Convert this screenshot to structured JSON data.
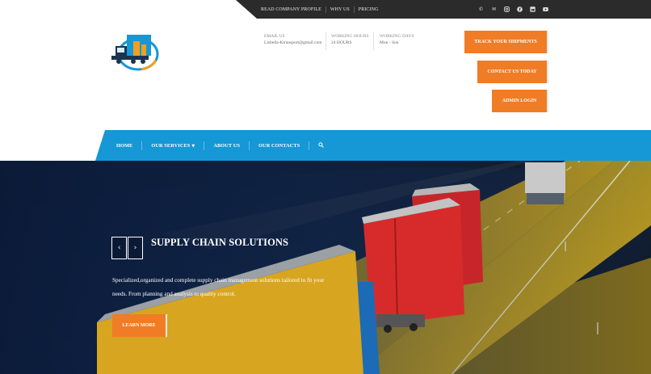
{
  "topnav": {
    "items": [
      "READ COMPANY PROFILE",
      "WHY US",
      "PRICING"
    ]
  },
  "social_icons": [
    "phone-icon",
    "mail-icon",
    "instagram-icon",
    "facebook-icon",
    "linkedin-icon",
    "youtube-icon"
  ],
  "header": {
    "email_label": "EMAIL US",
    "email_value": "Lisbella-Ktransport@gmail.com",
    "hours_label": "WORKING HOURS",
    "hours_value": "24 HOURS",
    "days_label": "WORKING DAYS",
    "days_value": "Mon - Sun"
  },
  "buttons": {
    "track": "TRACK YOUR SHIPMENTS",
    "contact": "CONTACT US TODAY",
    "admin": "ADMIN LOGIN"
  },
  "mainnav": {
    "home": "HOME",
    "services": "OUR SERVICES",
    "about": "ABOUT US",
    "contacts": "OUR CONTACTS"
  },
  "hero": {
    "title": "SUPPLY CHAIN SOLUTIONS",
    "description": "Specialized,organized and complete supply chain management solutions tailored to fit your needs. From planning and analysis to quality control.",
    "cta": "LEARN MORE"
  },
  "colors": {
    "accent_orange": "#f07c26",
    "nav_blue": "#1697d6",
    "topbar_dark": "#2b2b2b"
  }
}
